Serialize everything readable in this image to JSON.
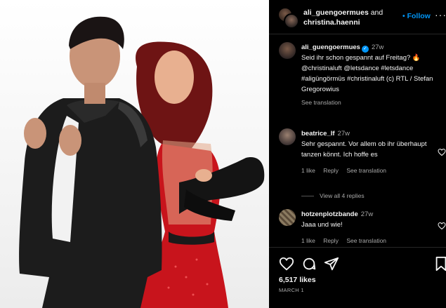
{
  "header": {
    "user1": "ali_guengoermues",
    "and": "and",
    "user2": "christina.haenni",
    "follow": "• Follow",
    "more": "···"
  },
  "caption": {
    "username": "ali_guengoermues",
    "verified_icon": "✓",
    "time": "27w",
    "text": "Seid ihr schon gespannt auf Freitag? 🔥 @christinaluft @letsdance #letsdance #aligüngörmüs #christinaluft (c) RTL / Stefan Gregorowius",
    "see_translation": "See translation"
  },
  "comments": [
    {
      "username": "beatrice_lf",
      "time": "27w",
      "text": "Sehr gespannt. Vor allem ob ihr überhaupt tanzen könnt. Ich hoffe es",
      "likes": "1 like",
      "reply": "Reply",
      "see_translation": "See translation"
    },
    {
      "username": "hotzenplotzbande",
      "time": "27w",
      "text": "Jaaa und wie!",
      "likes": "1 like",
      "reply": "Reply",
      "see_translation": "See translation"
    }
  ],
  "view_replies": "View all 4 replies",
  "footer": {
    "likes": "6,517 likes",
    "date": "MARCH 1"
  },
  "colors": {
    "accent": "#0095f6",
    "background": "#000000",
    "muted_text": "#a8a8a8"
  }
}
